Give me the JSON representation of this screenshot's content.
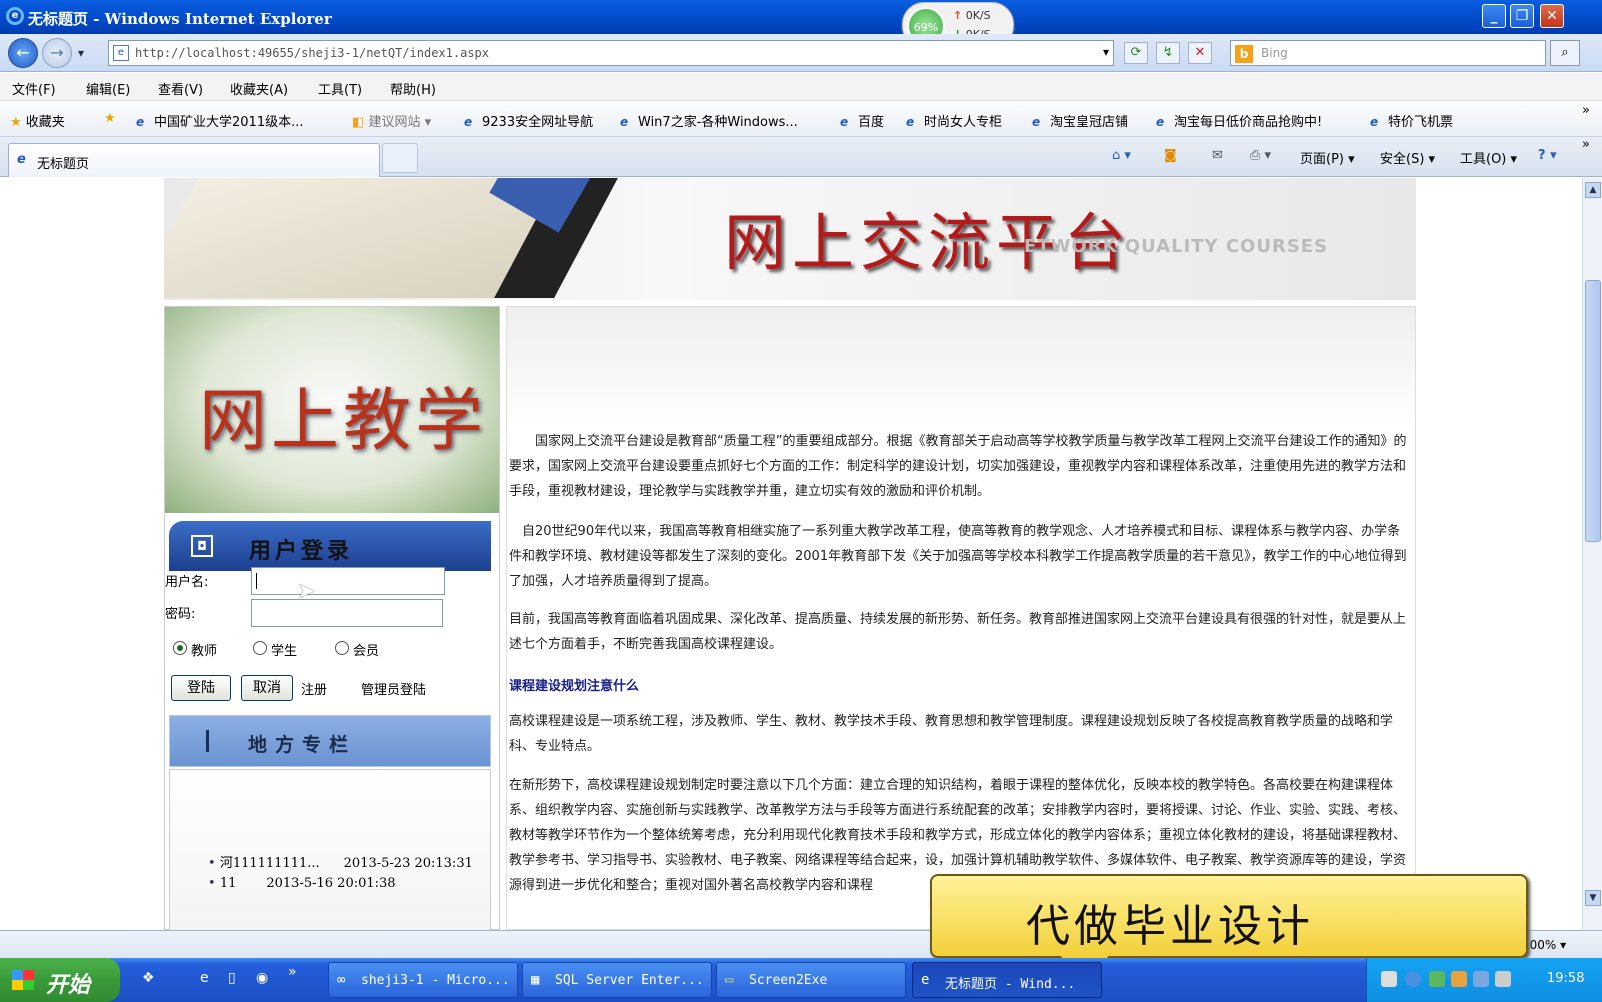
{
  "window": {
    "title": "无标题页 - Windows Internet Explorer",
    "minimize": "_",
    "restore": "❐",
    "close": "✕"
  },
  "netmeter": {
    "percent": "69%",
    "up_arrow": "↑",
    "down_arrow": "↓",
    "upload": "0K/S",
    "download": "0K/S"
  },
  "navigation": {
    "back_icon": "←",
    "forward_icon": "→",
    "dropdown_icon": "▾",
    "address": "http://localhost:49655/sheji3-1/netQT/index1.aspx",
    "go_icon": "⟳",
    "refresh_icon": "↯",
    "stop_icon": "✕",
    "search_engine": "b",
    "search_placeholder": "Bing",
    "search_icon": "⌕"
  },
  "menu": [
    "文件(F)",
    "编辑(E)",
    "查看(V)",
    "收藏夹(A)",
    "工具(T)",
    "帮助(H)"
  ],
  "favorites": {
    "label": "收藏夹",
    "items": [
      "中国矿业大学2011级本...",
      "建议网站 ▾",
      "9233安全网址导航",
      "Win7之家-各种Windows...",
      "百度",
      "时尚女人专柜",
      "淘宝皇冠店铺",
      "淘宝每日低价商品抢购中!",
      "特价飞机票"
    ],
    "more": "»"
  },
  "tab": {
    "title": "无标题页"
  },
  "commandbar": {
    "page": "页面(P) ▾",
    "safety": "安全(S) ▾",
    "tools": "工具(O) ▾",
    "help": "? ▾",
    "more": "»"
  },
  "site": {
    "banner_title": "网上交流平台",
    "banner_subtitle": "ETWORK QUALITY COURSES",
    "side_image_text": "网上教学",
    "login_header": "用户登录",
    "username_label": "用户名:",
    "password_label": "密码:",
    "roles": [
      "教师",
      "学生",
      "会员"
    ],
    "selected_role": "教师",
    "login_button": "登陆",
    "cancel_button": "取消",
    "register_link": "注册",
    "admin_link": "管理员登陆",
    "local_header": "地方专栏",
    "news": [
      {
        "title": "河111111111...",
        "date": "2013-5-23 20:13:31"
      },
      {
        "title": "11",
        "date": "2013-5-16 20:01:38"
      }
    ],
    "paragraphs": [
      "　　国家网上交流平台建设是教育部“质量工程”的重要组成部分。根据《教育部关于启动高等学校教学质量与教学改革工程网上交流平台建设工作的通知》的要求，国家网上交流平台建设要重点抓好七个方面的工作：制定科学的建设计划，切实加强建设，重视教学内容和课程体系改革，注重使用先进的教学方法和手段，重视教材建设，理论教学与实践教学并重，建立切实有效的激励和评价机制。",
      "　自20世纪90年代以来，我国高等教育相继实施了一系列重大教学改革工程，使高等教育的教学观念、人才培养模式和目标、课程体系与教学内容、办学条件和教学环境、教材建设等都发生了深刻的变化。2001年教育部下发《关于加强高等学校本科教学工作提高教学质量的若干意见》，教学工作的中心地位得到了加强，人才培养质量得到了提高。",
      "目前，我国高等教育面临着巩固成果、深化改革、提高质量、持续发展的新形势、新任务。教育部推进国家网上交流平台建设具有很强的针对性，就是要从上述七个方面着手，不断完善我国高校课程建设。"
    ],
    "section_heading": "课程建设规划注意什么",
    "paragraphs2": [
      "高校课程建设是一项系统工程，涉及教师、学生、教材、教学技术手段、教育思想和教学管理制度。课程建设规划反映了各校提高教育教学质量的战略和学科、专业特点。",
      "在新形势下，高校课程建设规划制定时要注意以下几个方面：建立合理的知识结构，着眼于课程的整体优化，反映本校的教学特色。各高校要在构建课程体系、组织教学内容、实施创新与实践教学、改革教学方法与手段等方面进行系统配套的改革；安排教学内容时，要将授课、讨论、作业、实验、实践、考核、教材等教学环节作为一个整体统筹考虑，充分利用现代化教育技术手段和教学方式，形成立体化的教学内容体系；重视立体化教材的建设，将基础课程教材、教学参考书、学习指导书、实验教材、电子教案、网络课程等结合起来，设，加强计算机辅助教学软件、多媒体软件、电子教案、教学资源库等的建设，学资源得到进一步优化和整合；重视对国外著名高校教学内容和课程"
    ]
  },
  "overlay": {
    "ad_text": "代做毕业设计"
  },
  "statusbar": {
    "zoom": "100% ▾"
  },
  "taskbar": {
    "start": "开始",
    "tasks": [
      "sheji3-1 - Micro...",
      "SQL Server Enter...",
      "Screen2Exe",
      "无标题页 - Wind..."
    ],
    "quicklaunch_more": "»",
    "clock": "19:58"
  }
}
